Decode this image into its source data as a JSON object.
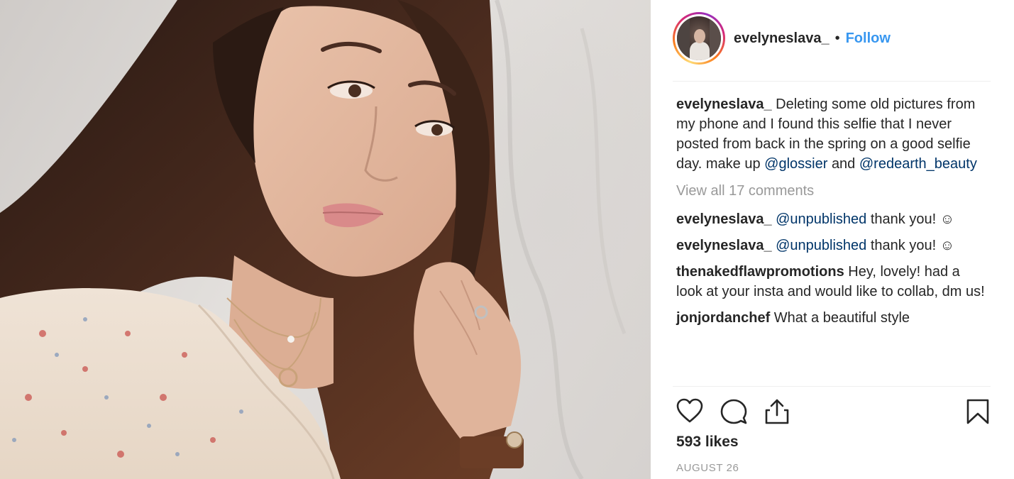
{
  "post": {
    "photo_icon": "selfie-photo",
    "author": "evelyneslava_",
    "separator": "•",
    "follow_label": "Follow",
    "caption": {
      "username": "evelyneslava_",
      "text_part1": "Deleting some old pictures from my phone and I found this selfie that I never posted from back in the spring on a good selfie day. make up",
      "mention1": "@glossier",
      "text_part2": "and",
      "mention2": "@redearth_beauty"
    },
    "view_all_comments": "View all 17 comments",
    "comments": [
      {
        "username": "evelyneslava_",
        "mention": "@unpublished",
        "text": "thank you! ☺"
      },
      {
        "username": "evelyneslava_",
        "mention": "@unpublished",
        "text": "thank you! ☺"
      },
      {
        "username": "thenakedflawpromotions",
        "mention": "",
        "text": "Hey, lovely! had a look at your insta and would like to collab, dm us!"
      },
      {
        "username": "jonjordanchef",
        "mention": "",
        "text": "What a beautiful style"
      }
    ],
    "actions": {
      "like_icon": "heart-icon",
      "comment_icon": "comment-bubble-icon",
      "share_icon": "share-upload-icon",
      "save_icon": "bookmark-icon"
    },
    "likes": "593 likes",
    "date": "AUGUST 26",
    "colors": {
      "link_blue": "#3897f0",
      "mention_blue": "#003569",
      "muted_gray": "#999999",
      "text_dark": "#262626"
    }
  }
}
